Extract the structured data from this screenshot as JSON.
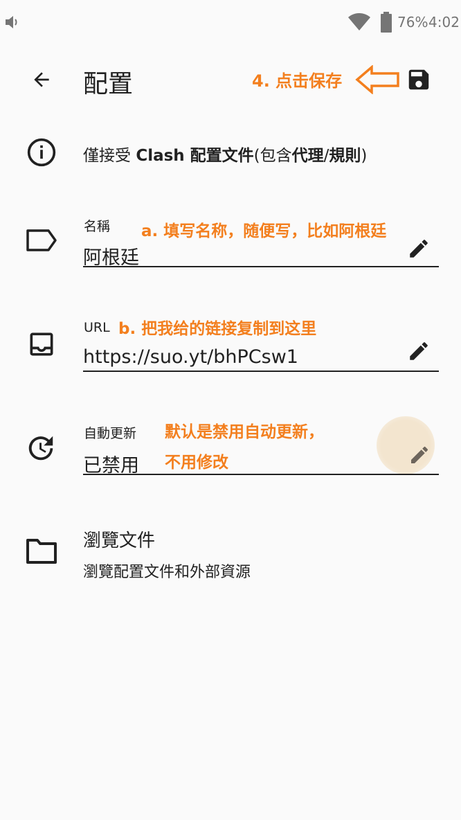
{
  "status_bar": {
    "battery_percent": "76%",
    "time": "4:02",
    "icons": [
      "volume-icon",
      "wifi-icon",
      "battery-icon"
    ]
  },
  "app_bar": {
    "title": "配置",
    "icons": [
      "back-arrow-icon",
      "save-icon"
    ]
  },
  "notice": {
    "prefix": "僅接受 ",
    "bold1": "Clash 配置文件",
    "mid": "(包含",
    "bold2": "代理",
    "slash": "/",
    "bold3": "規則",
    "suffix": ")"
  },
  "fields": {
    "name": {
      "label": "名稱",
      "value": "阿根廷"
    },
    "url": {
      "label": "URL",
      "value": "https://suo.yt/bhPCsw1"
    },
    "auto_update": {
      "label": "自動更新",
      "value": "已禁用"
    }
  },
  "browse": {
    "title": "瀏覽文件",
    "subtitle": "瀏覽配置文件和外部資源"
  },
  "annotations": {
    "save_hint": "4. 点击保存",
    "name_hint": "a. 填写名称，随便写，比如阿根廷",
    "url_hint": "b. 把我给的链接复制到这里",
    "update_hint_1": "默认是禁用自动更新，",
    "update_hint_2": "不用修改",
    "color": "#f37f1e"
  }
}
